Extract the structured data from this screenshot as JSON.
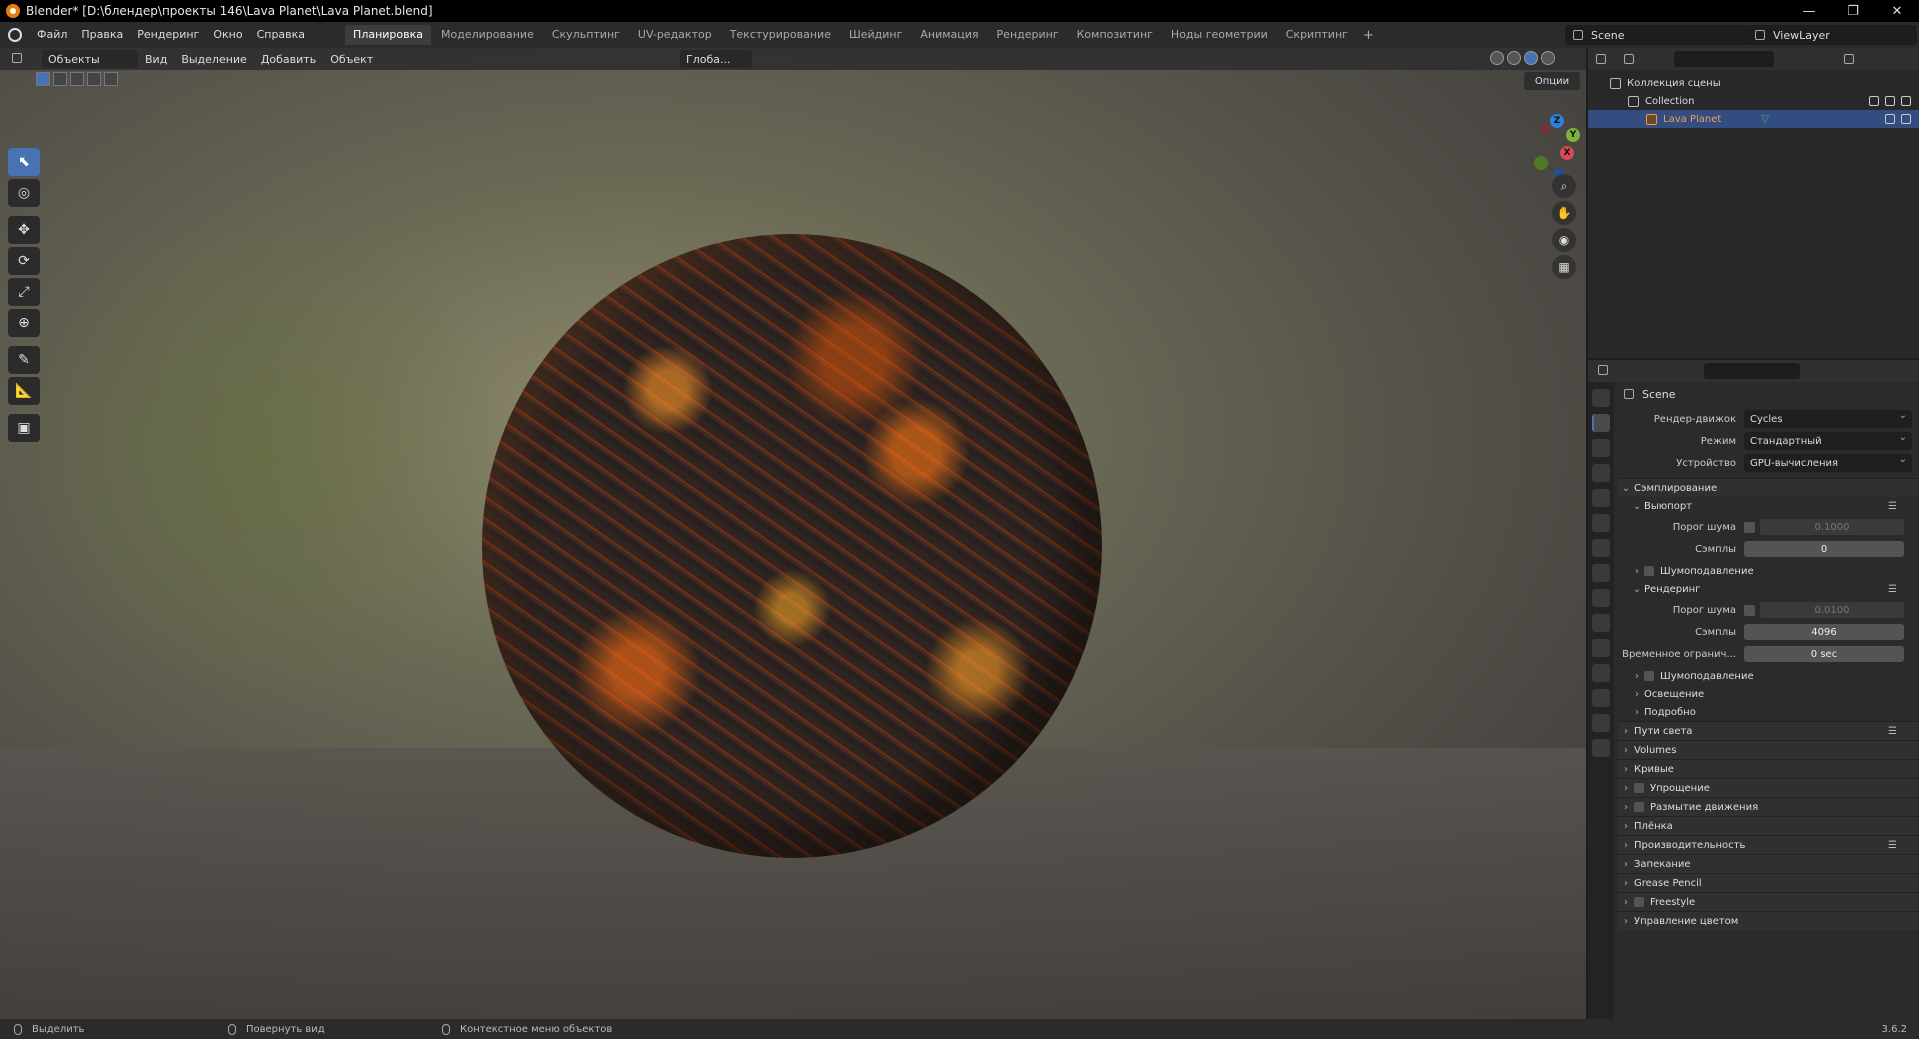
{
  "window": {
    "title": "Blender* [D:\\блендер\\проекты 146\\Lava Planet\\Lava Planet.blend]",
    "controls": [
      "—",
      "❐",
      "✕"
    ]
  },
  "menubar": {
    "menus": [
      "Файл",
      "Правка",
      "Рендеринг",
      "Окно",
      "Справка"
    ],
    "workspaces": [
      "Планировка",
      "Моделирование",
      "Скульптинг",
      "UV-редактор",
      "Текстурирование",
      "Шейдинг",
      "Анимация",
      "Рендеринг",
      "Композитинг",
      "Ноды геометрии",
      "Скриптинг"
    ],
    "active_workspace": "Планировка",
    "add_tab": "+",
    "scene": "Scene",
    "view_layer": "ViewLayer"
  },
  "viewport": {
    "mode": "Объекты",
    "menus": [
      "Вид",
      "Выделение",
      "Добавить",
      "Объект"
    ],
    "orientation": "Глоба...",
    "options_label": "Опции",
    "gizmo": {
      "x": "X",
      "y": "Y",
      "z": "Z"
    }
  },
  "outliner": {
    "root": "Коллекция сцены",
    "collection": "Collection",
    "object": "Lava Planet"
  },
  "properties": {
    "scene_title": "Scene",
    "render_engine_label": "Рендер-движок",
    "render_engine": "Cycles",
    "mode_label": "Режим",
    "mode_value": "Стандартный",
    "device_label": "Устройство",
    "device_value": "GPU-вычисления",
    "sampling": "Сэмплирование",
    "viewport_section": "Выюпорт",
    "noise_threshold_label": "Порог шума",
    "viewport_noise_threshold": "0.1000",
    "samples_label": "Сэмплы",
    "viewport_samples": "0",
    "denoise": "Шумоподавление",
    "render_section": "Рендеринг",
    "render_noise_threshold": "0.0100",
    "render_samples": "4096",
    "time_limit_label": "Временное огранич...",
    "time_limit": "0 sec",
    "render_denoise": "Шумоподавление",
    "lights": "Освещение",
    "advanced": "Подробно",
    "panels": [
      "Пути света",
      "Volumes",
      "Кривые",
      "Упрощение",
      "Размытие движения",
      "Плёнка",
      "Производительность",
      "Запекание",
      "Grease Pencil",
      "Freestyle",
      "Управление цветом"
    ]
  },
  "statusbar": {
    "select": "Выделить",
    "rotate": "Повернуть вид",
    "context": "Контекстное меню объектов",
    "version": "3.6.2"
  }
}
